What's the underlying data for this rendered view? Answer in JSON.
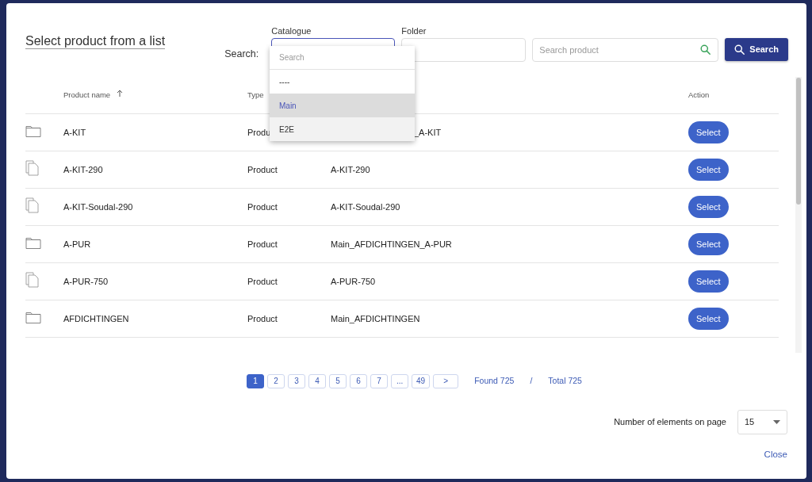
{
  "dialog": {
    "title": "Select product from a list",
    "close": "Close"
  },
  "search": {
    "label": "Search:",
    "button": "Search",
    "catalogue": {
      "label": "Catalogue",
      "expanded": true,
      "filter_placeholder": "Search",
      "options": [
        {
          "label": "----",
          "selected": false,
          "hovered": false
        },
        {
          "label": "Main",
          "selected": true,
          "hovered": false
        },
        {
          "label": "E2E",
          "selected": false,
          "hovered": true
        }
      ]
    },
    "folder": {
      "label": "Folder"
    },
    "product": {
      "placeholder": "Search product"
    }
  },
  "table": {
    "headers": {
      "name": {
        "label": "Product name",
        "sorted": true
      },
      "type": {
        "label": "Type"
      },
      "action": {
        "label": "Action"
      }
    },
    "rows": [
      {
        "kind": "folder",
        "name": "A-KIT",
        "type": "Produ",
        "path": "_A-KIT",
        "covered": true,
        "action": "Select"
      },
      {
        "kind": "file",
        "name": "A-KIT-290",
        "type": "Product",
        "path": "A-KIT-290",
        "covered": false,
        "action": "Select"
      },
      {
        "kind": "file",
        "name": "A-KIT-Soudal-290",
        "type": "Product",
        "path": "A-KIT-Soudal-290",
        "covered": false,
        "action": "Select"
      },
      {
        "kind": "folder",
        "name": "A-PUR",
        "type": "Product",
        "path": "Main_AFDICHTINGEN_A-PUR",
        "covered": false,
        "action": "Select"
      },
      {
        "kind": "file",
        "name": "A-PUR-750",
        "type": "Product",
        "path": "A-PUR-750",
        "covered": false,
        "action": "Select"
      },
      {
        "kind": "folder",
        "name": "AFDICHTINGEN",
        "type": "Product",
        "path": "Main_AFDICHTINGEN",
        "covered": false,
        "action": "Select"
      }
    ]
  },
  "pagination": {
    "pages": [
      {
        "label": "1",
        "selected": true
      },
      {
        "label": "2",
        "selected": false
      },
      {
        "label": "3",
        "selected": false
      },
      {
        "label": "4",
        "selected": false
      },
      {
        "label": "5",
        "selected": false
      },
      {
        "label": "6",
        "selected": false
      },
      {
        "label": "7",
        "selected": false
      },
      {
        "label": "...",
        "selected": false
      },
      {
        "label": "49",
        "selected": false
      }
    ],
    "next": ">",
    "found": "Found 725",
    "separator": "/",
    "total": "Total 725"
  },
  "page_size": {
    "label": "Number of elements on page",
    "value": "15"
  }
}
